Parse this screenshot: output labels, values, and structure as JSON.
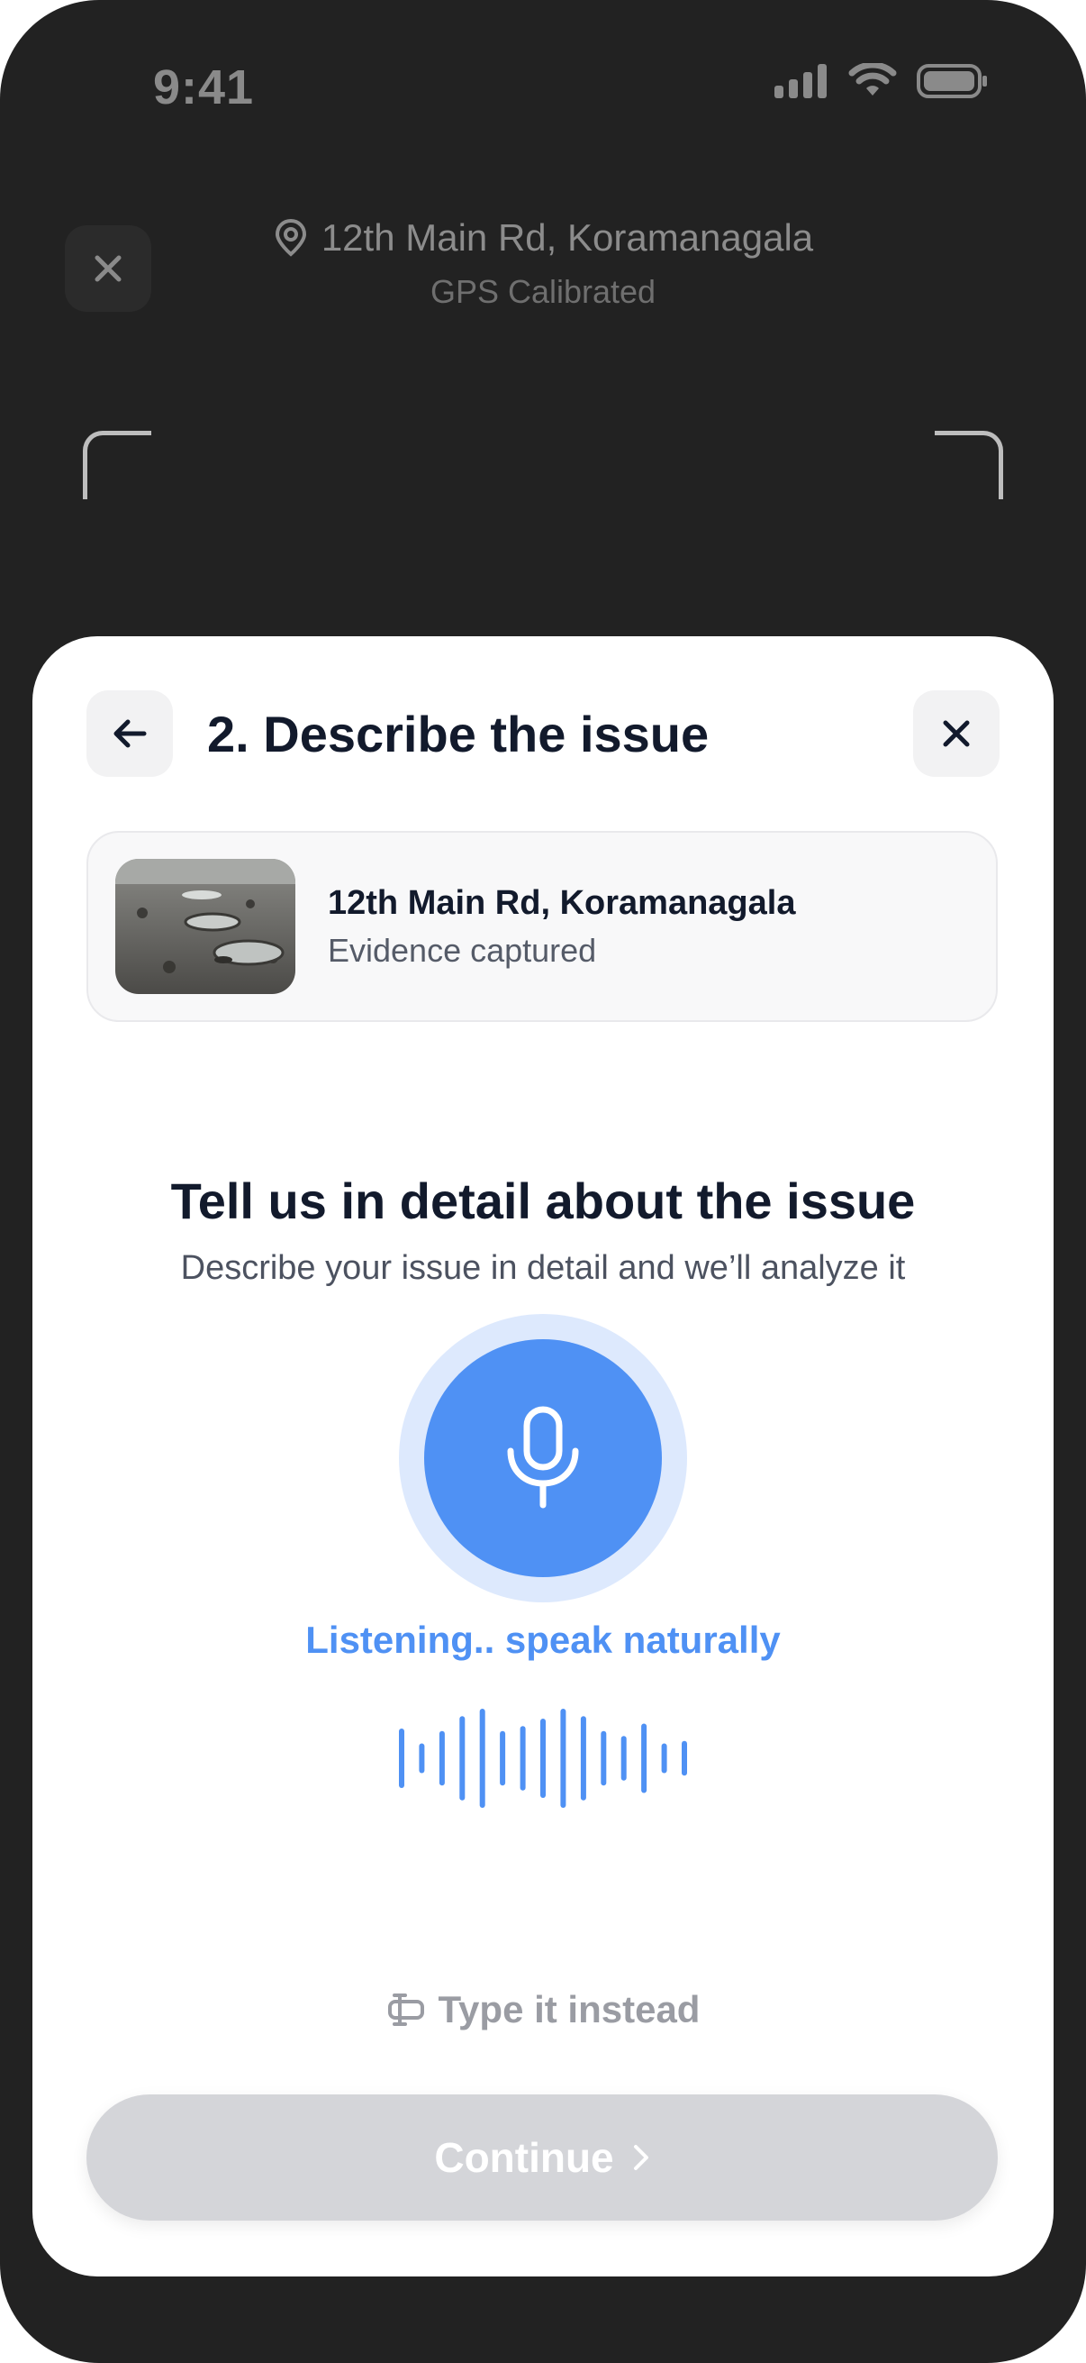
{
  "status_bar": {
    "time": "9:41",
    "icons": [
      "signal-icon",
      "wifi-icon",
      "battery-icon"
    ]
  },
  "camera": {
    "close_icon": "close-icon",
    "address": "12th Main Rd, Koramanagala",
    "gps_status": "GPS Calibrated",
    "location_icon": "location-pin-icon"
  },
  "sheet": {
    "back_icon": "arrow-left-icon",
    "title": "2. Describe the issue",
    "close_icon": "close-icon",
    "evidence": {
      "title": "12th Main Rd, Koramanagala",
      "subtitle": "Evidence captured"
    },
    "prompt": {
      "heading": "Tell us in detail about the issue",
      "subheading": "Describe your issue in detail and we’ll analyze it"
    },
    "mic_icon": "microphone-icon",
    "listening_text": "Listening.. speak naturally",
    "waveform_levels": [
      0.6,
      0.3,
      0.55,
      0.85,
      1.0,
      0.55,
      0.65,
      0.8,
      1.0,
      0.85,
      0.55,
      0.45,
      0.7,
      0.3,
      0.35
    ],
    "type_instead": "Type it instead",
    "continue_label": "Continue"
  },
  "colors": {
    "accent": "#4f91f4",
    "accent_light": "#dde9fd",
    "disabled_button": "#d4d5d9",
    "dark_background": "#222222",
    "title_text": "#121a2c"
  }
}
